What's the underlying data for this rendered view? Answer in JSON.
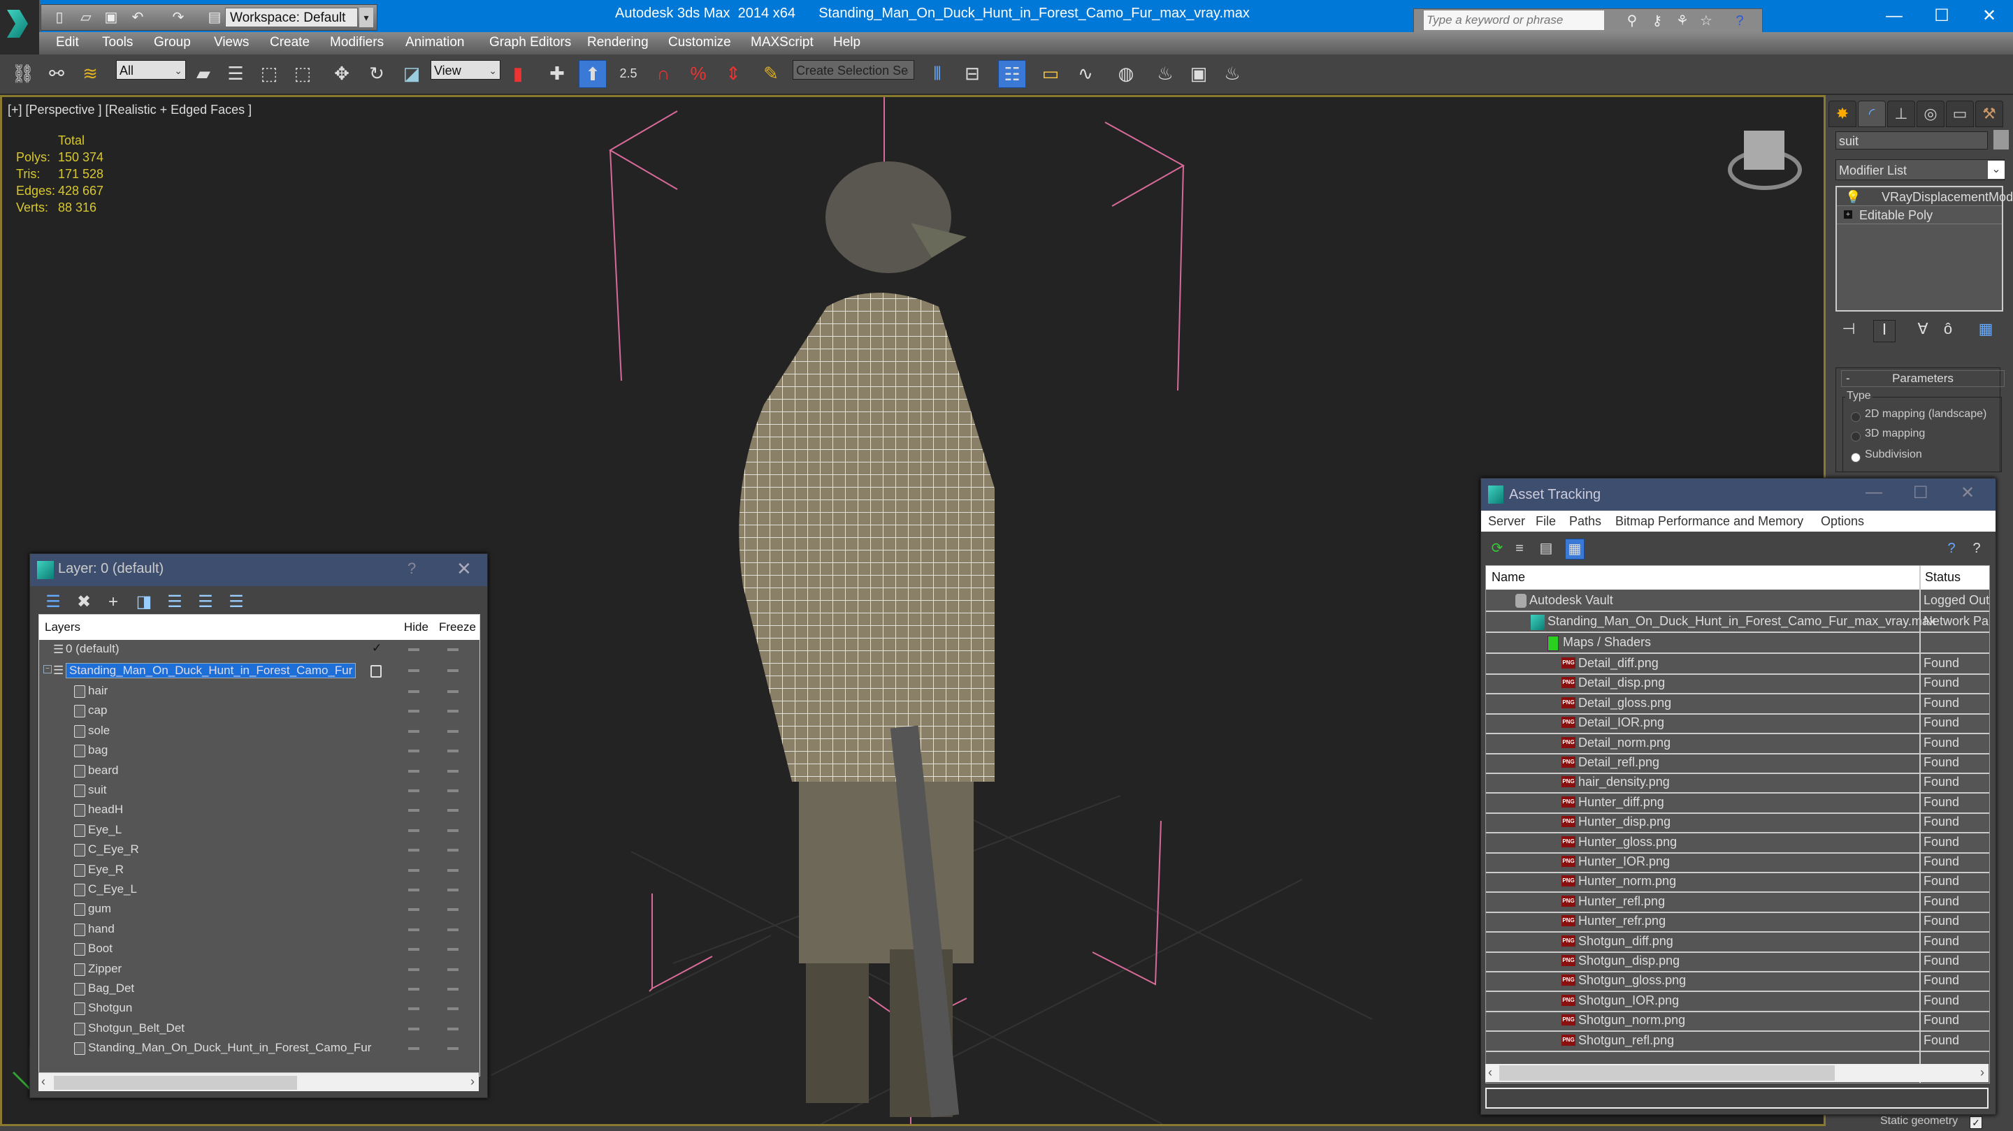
{
  "app": {
    "title": "Autodesk 3ds Max  2014 x64",
    "file": "Standing_Man_On_Duck_Hunt_in_Forest_Camo_Fur_max_vray.max",
    "workspace": "Workspace: Default",
    "search_placeholder": "Type a keyword or phrase",
    "accent": "#0078d7"
  },
  "menu": [
    "Edit",
    "Tools",
    "Group",
    "Views",
    "Create",
    "Modifiers",
    "Animation",
    "Graph Editors",
    "Rendering",
    "Customize",
    "MAXScript",
    "Help"
  ],
  "toolbar": {
    "selection_filter": "All",
    "reference_coord": "View",
    "snap_angle": "2.5",
    "named_selection": "Create Selection Se"
  },
  "viewport": {
    "label": "[+] [Perspective ] [Realistic + Edged Faces ]",
    "stats": {
      "header": "Total",
      "rows": [
        {
          "label": "Polys:",
          "value": "150 374"
        },
        {
          "label": "Tris:",
          "value": "171 528"
        },
        {
          "label": "Edges:",
          "value": "428 667"
        },
        {
          "label": "Verts:",
          "value": "88 316"
        }
      ]
    }
  },
  "command_panel": {
    "object_name": "suit",
    "modifier_list": "Modifier List",
    "stack": [
      "VRayDisplacementMod",
      "Editable Poly"
    ],
    "parameters_title": "Parameters",
    "type_label": "Type",
    "type_options": [
      {
        "label": "2D mapping (landscape)",
        "selected": false
      },
      {
        "label": "3D mapping",
        "selected": false
      },
      {
        "label": "Subdivision",
        "selected": true
      }
    ],
    "static_geometry": "Static geometry"
  },
  "layer_dialog": {
    "title": "Layer: 0 (default)",
    "help": "?",
    "columns": {
      "layers": "Layers",
      "hide": "Hide",
      "freeze": "Freeze"
    },
    "layers": [
      {
        "name": "0 (default)",
        "level": 0,
        "current": true
      },
      {
        "name": "Standing_Man_On_Duck_Hunt_in_Forest_Camo_Fur",
        "level": 0,
        "selected": true
      }
    ],
    "objects": [
      "hair",
      "cap",
      "sole",
      "bag",
      "beard",
      "suit",
      "headH",
      "Eye_L",
      "C_Eye_R",
      "Eye_R",
      "C_Eye_L",
      "gum",
      "hand",
      "Boot",
      "Zipper",
      "Bag_Det",
      "Shotgun",
      "Shotgun_Belt_Det",
      "Standing_Man_On_Duck_Hunt_in_Forest_Camo_Fur"
    ]
  },
  "asset_dialog": {
    "title": "Asset Tracking",
    "menu": [
      "Server",
      "File",
      "Paths",
      "Bitmap Performance and Memory",
      "Options"
    ],
    "columns": {
      "name": "Name",
      "status": "Status"
    },
    "vault": {
      "name": "Autodesk Vault",
      "status": "Logged Out"
    },
    "scene": {
      "name": "Standing_Man_On_Duck_Hunt_in_Forest_Camo_Fur_max_vray.max",
      "status": "Network Pa"
    },
    "maps_group": "Maps / Shaders",
    "files": [
      {
        "name": "Detail_diff.png",
        "status": "Found"
      },
      {
        "name": "Detail_disp.png",
        "status": "Found"
      },
      {
        "name": "Detail_gloss.png",
        "status": "Found"
      },
      {
        "name": "Detail_IOR.png",
        "status": "Found"
      },
      {
        "name": "Detail_norm.png",
        "status": "Found"
      },
      {
        "name": "Detail_refl.png",
        "status": "Found"
      },
      {
        "name": "hair_density.png",
        "status": "Found"
      },
      {
        "name": "Hunter_diff.png",
        "status": "Found"
      },
      {
        "name": "Hunter_disp.png",
        "status": "Found"
      },
      {
        "name": "Hunter_gloss.png",
        "status": "Found"
      },
      {
        "name": "Hunter_IOR.png",
        "status": "Found"
      },
      {
        "name": "Hunter_norm.png",
        "status": "Found"
      },
      {
        "name": "Hunter_refl.png",
        "status": "Found"
      },
      {
        "name": "Hunter_refr.png",
        "status": "Found"
      },
      {
        "name": "Shotgun_diff.png",
        "status": "Found"
      },
      {
        "name": "Shotgun_disp.png",
        "status": "Found"
      },
      {
        "name": "Shotgun_gloss.png",
        "status": "Found"
      },
      {
        "name": "Shotgun_IOR.png",
        "status": "Found"
      },
      {
        "name": "Shotgun_norm.png",
        "status": "Found"
      },
      {
        "name": "Shotgun_refl.png",
        "status": "Found"
      }
    ]
  }
}
